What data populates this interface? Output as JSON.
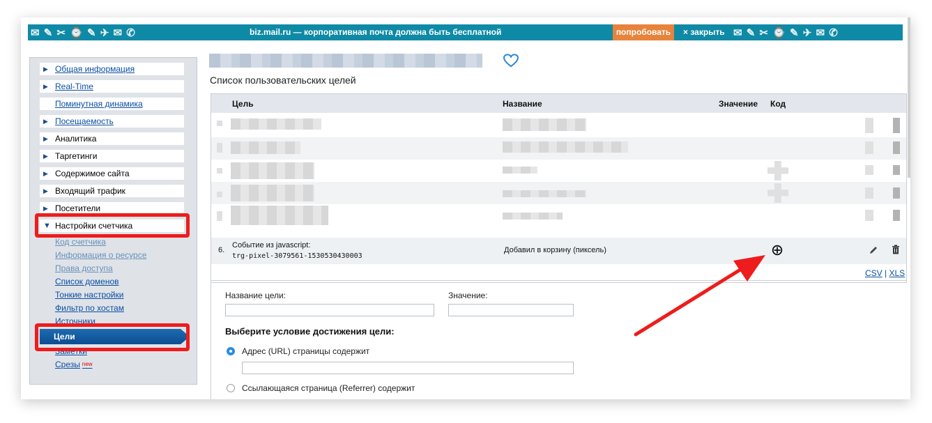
{
  "banner": {
    "text": "biz.mail.ru — корпоративная почта должна быть бесплатной",
    "try_label": "попробовать",
    "close_label": "× закрыть",
    "deco": "✉ ✎ ✂ ⌚ ✎ ✈ ✉ ✆"
  },
  "sidebar": {
    "items": [
      {
        "label": "Общая информация"
      },
      {
        "label": "Real-Time"
      },
      {
        "label": "Поминутная динамика"
      },
      {
        "label": "Посещаемость"
      },
      {
        "label": "Аналитика"
      },
      {
        "label": "Таргетинги"
      },
      {
        "label": "Содержимое сайта"
      },
      {
        "label": "Входящий трафик"
      },
      {
        "label": "Посетители"
      },
      {
        "label": "Настройки счетчика"
      }
    ],
    "subitems": [
      {
        "label": "Код счетчика"
      },
      {
        "label": "Информация о ресурсе"
      },
      {
        "label": "Права доступа"
      },
      {
        "label": "Список доменов"
      },
      {
        "label": "Тонкие настройки"
      },
      {
        "label": "Фильтр по хостам"
      },
      {
        "label": "Источники"
      },
      {
        "label": "Цели"
      },
      {
        "label": "Заметки"
      },
      {
        "label": "Срезы"
      }
    ],
    "new_badge": "new"
  },
  "main": {
    "list_title": "Список пользовательских целей",
    "columns": {
      "goal": "Цель",
      "name": "Название",
      "value": "Значение",
      "code": "Код"
    },
    "row6": {
      "num": "6.",
      "event": "Событие из javascript:",
      "code": "trg-pixel-3079561-1530530430003",
      "name": "Добавил в корзину (пиксель)"
    },
    "export": {
      "csv": "CSV",
      "sep": "|",
      "xls": "XLS"
    }
  },
  "form": {
    "goal_name_label": "Название цели:",
    "value_label": "Значение:",
    "condition_heading": "Выберите условие достижения цели:",
    "option_url": "Адрес (URL) страницы содержит",
    "option_referrer": "Ссылающаяся страница (Referrer) содержит"
  },
  "colors": {
    "banner_bg": "#0f8aa6",
    "try_bg": "#e7833b",
    "highlight": "#ee1c1c",
    "active_nav": "#0c4d92",
    "link": "#0b4ea2"
  }
}
